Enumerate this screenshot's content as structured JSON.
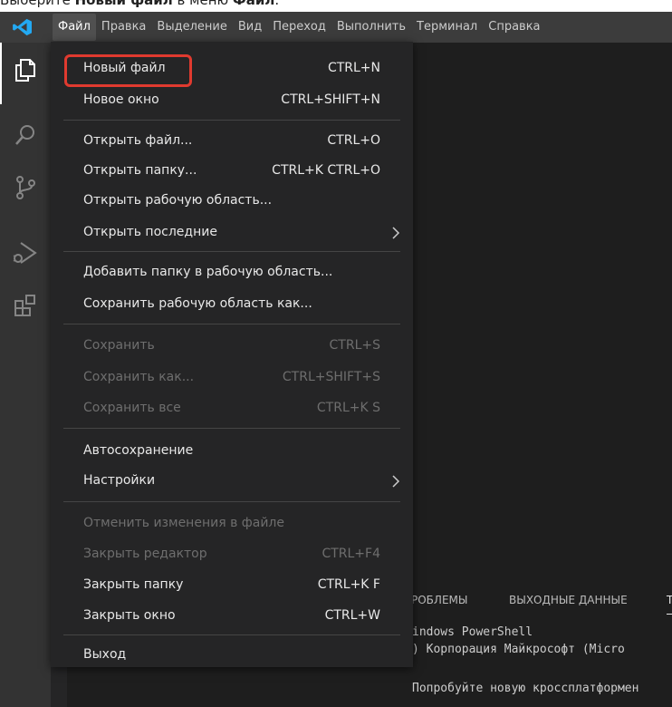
{
  "caption": {
    "prefix": "Выберите ",
    "bold1": "Новый файл",
    "middle": " в меню ",
    "bold2": "Файл",
    "suffix": "."
  },
  "menubar": [
    "Файл",
    "Правка",
    "Выделение",
    "Вид",
    "Переход",
    "Выполнить",
    "Терминал",
    "Справка"
  ],
  "activity_icons": [
    "explorer-icon",
    "search-icon",
    "source-control-icon",
    "run-debug-icon",
    "extensions-icon"
  ],
  "file_menu": [
    {
      "label": "Новый файл",
      "shortcut": "CTRL+N"
    },
    {
      "label": "Новое окно",
      "shortcut": "CTRL+SHIFT+N"
    },
    {
      "label": "Открыть файл...",
      "shortcut": "CTRL+O"
    },
    {
      "label": "Открыть папку...",
      "shortcut": "CTRL+K CTRL+O"
    },
    {
      "label": "Открыть рабочую область...",
      "shortcut": ""
    },
    {
      "label": "Открыть последние",
      "shortcut": ""
    },
    {
      "label": "Добавить папку в рабочую область...",
      "shortcut": ""
    },
    {
      "label": "Сохранить рабочую область как...",
      "shortcut": ""
    },
    {
      "label": "Сохранить",
      "shortcut": "CTRL+S"
    },
    {
      "label": "Сохранить как...",
      "shortcut": "CTRL+SHIFT+S"
    },
    {
      "label": "Сохранить все",
      "shortcut": "CTRL+K S"
    },
    {
      "label": "Автосохранение",
      "shortcut": ""
    },
    {
      "label": "Настройки",
      "shortcut": ""
    },
    {
      "label": "Отменить изменения в файле",
      "shortcut": ""
    },
    {
      "label": "Закрыть редактор",
      "shortcut": "CTRL+F4"
    },
    {
      "label": "Закрыть папку",
      "shortcut": "CTRL+K F"
    },
    {
      "label": "Закрыть окно",
      "shortcut": "CTRL+W"
    },
    {
      "label": "Выход",
      "shortcut": ""
    }
  ],
  "panel": {
    "tab1": "РОБЛЕМЫ",
    "tab2": "ВЫХОДНЫЕ ДАННЫЕ",
    "tab3": "Т"
  },
  "terminal": {
    "line1": "indows PowerShell",
    "line2": ") Корпорация Майкрософт (Micro",
    "line3": "Попробуйте новую кроссплатформен"
  },
  "colors": {
    "highlight": "#e03a2f",
    "vscode_blue": "#23a9f2"
  }
}
